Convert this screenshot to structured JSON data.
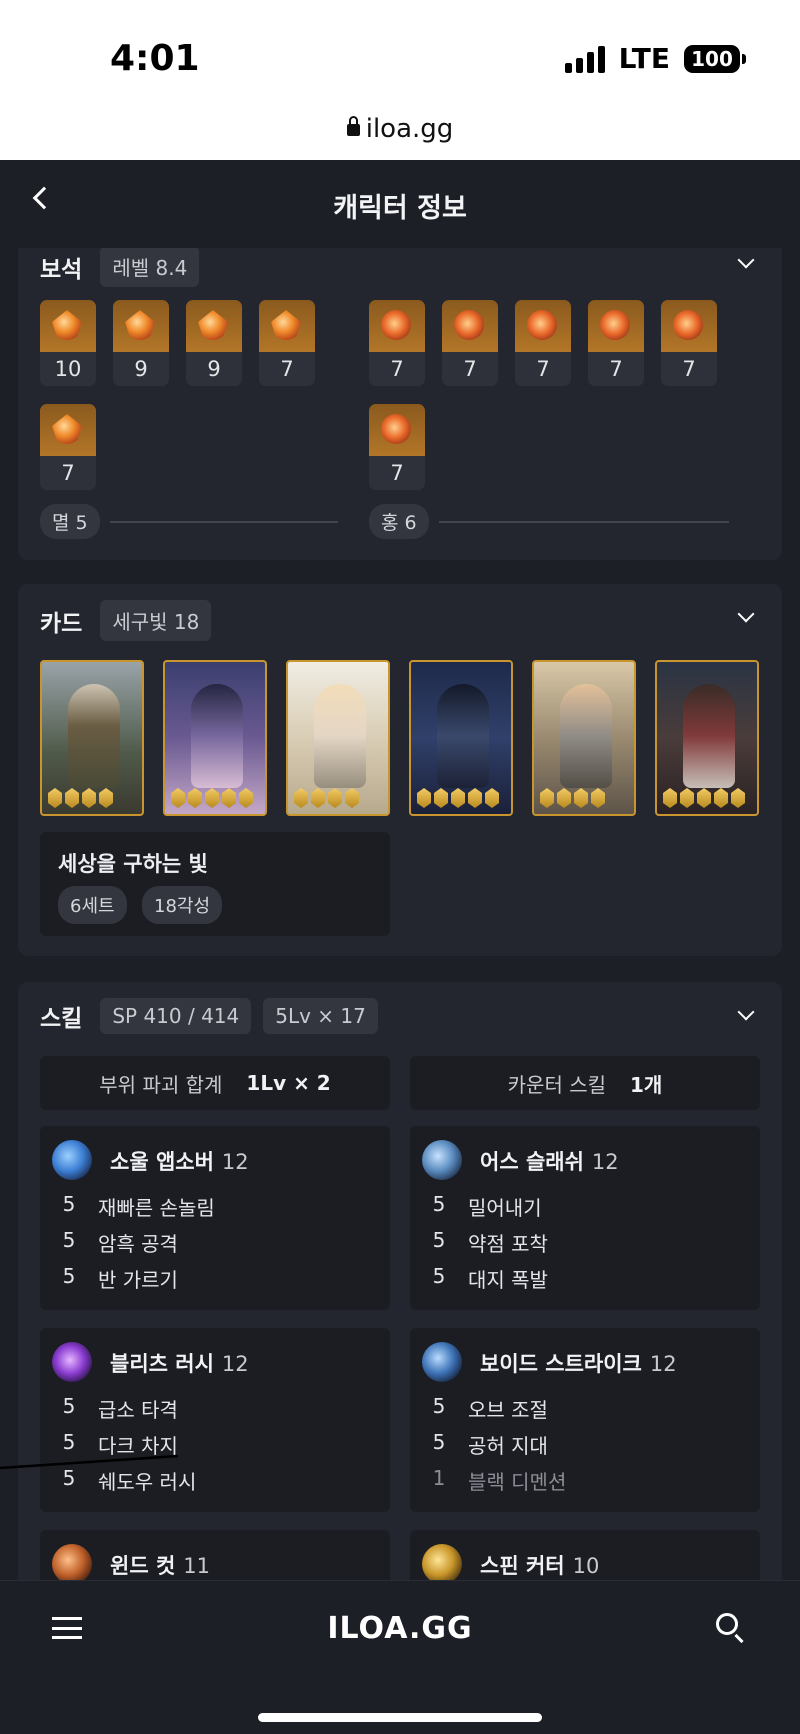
{
  "status": {
    "time": "4:01",
    "network": "LTE",
    "battery": "100"
  },
  "browser": {
    "url": "iloa.gg"
  },
  "header": {
    "title": "캐릭터 정보"
  },
  "gems": {
    "title": "보석",
    "level_chip": "레벨 8.4",
    "left_group": [
      "10",
      "9",
      "9",
      "7",
      "7"
    ],
    "right_group": [
      "7",
      "7",
      "7",
      "7",
      "7",
      "7"
    ],
    "left_summary": "멸 5",
    "right_summary": "홍 6"
  },
  "cards": {
    "title": "카드",
    "chip": "세구빛 18",
    "awakening": [
      4,
      5,
      4,
      5,
      4,
      5
    ],
    "set_name": "세상을 구하는 빛",
    "set_pills": [
      "6세트",
      "18각성"
    ]
  },
  "skills": {
    "title": "스킬",
    "sp_chip": "SP 410 / 414",
    "lv_chip": "5Lv × 17",
    "stats": [
      {
        "label": "부위 파괴 합계",
        "value": "1Lv × 2"
      },
      {
        "label": "카운터 스킬",
        "value": "1개"
      }
    ],
    "list": [
      {
        "name": "소울 앱소버",
        "level": "12",
        "icon_color": "#3d7fd4",
        "tripods": [
          {
            "lv": "5",
            "name": "재빠른 손놀림"
          },
          {
            "lv": "5",
            "name": "암흑 공격"
          },
          {
            "lv": "5",
            "name": "반 가르기"
          }
        ]
      },
      {
        "name": "어스 슬래쉬",
        "level": "12",
        "icon_color": "#5a8bbf",
        "tripods": [
          {
            "lv": "5",
            "name": "밀어내기"
          },
          {
            "lv": "5",
            "name": "약점 포착"
          },
          {
            "lv": "5",
            "name": "대지 폭발"
          }
        ]
      },
      {
        "name": "블리츠 러시",
        "level": "12",
        "icon_color": "#8a3dd1",
        "tripods": [
          {
            "lv": "5",
            "name": "급소 타격"
          },
          {
            "lv": "5",
            "name": "다크 차지"
          },
          {
            "lv": "5",
            "name": "쉐도우 러시"
          }
        ]
      },
      {
        "name": "보이드 스트라이크",
        "level": "12",
        "icon_color": "#3f74b8",
        "tripods": [
          {
            "lv": "5",
            "name": "오브 조절"
          },
          {
            "lv": "5",
            "name": "공허 지대"
          },
          {
            "lv": "1",
            "name": "블랙 디멘션"
          }
        ]
      },
      {
        "name": "윈드 컷",
        "level": "11",
        "icon_color": "#c0612a",
        "tripods": []
      },
      {
        "name": "스핀 커터",
        "level": "10",
        "icon_color": "#c89528",
        "tripods": []
      }
    ]
  },
  "bottom": {
    "brand": "ILOA.GG"
  }
}
